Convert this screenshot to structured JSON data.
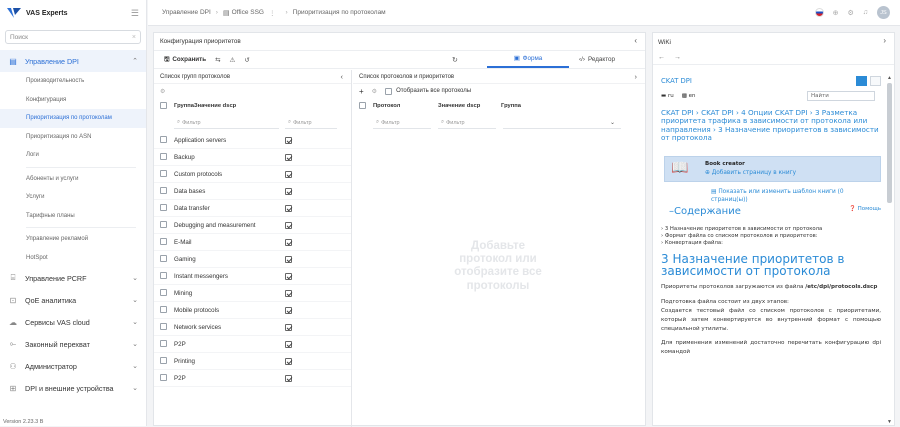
{
  "app": {
    "brand": "VAS Experts",
    "version": "Version 2.23.3 B"
  },
  "sidebar": {
    "search_placeholder": "Поиск",
    "groups": [
      {
        "label": "Управление DPI",
        "icon": "dpi-icon",
        "expanded": true
      },
      {
        "label": "Управление PCRF",
        "icon": "pcrf-icon"
      },
      {
        "label": "QoE аналитика",
        "icon": "qoe-icon"
      },
      {
        "label": "Сервисы VAS cloud",
        "icon": "cloud-icon"
      },
      {
        "label": "Законный перехват",
        "icon": "intercept-icon"
      },
      {
        "label": "Администратор",
        "icon": "admin-icon"
      },
      {
        "label": "DPI и внешние устройства",
        "icon": "devices-icon"
      }
    ],
    "dpi_items": [
      {
        "label": "Производительность"
      },
      {
        "label": "Конфигурация"
      },
      {
        "label": "Приоритизация по протоколам",
        "active": true
      },
      {
        "label": "Приоритизация по ASN"
      },
      {
        "label": "Логи"
      },
      {
        "label": "Абоненты и услуги"
      },
      {
        "label": "Услуги"
      },
      {
        "label": "Тарифные планы"
      },
      {
        "label": "Управление рекламой"
      },
      {
        "label": "HotSpot"
      }
    ]
  },
  "header": {
    "crumb1": "Управление DPI",
    "crumb2": "Office SSG",
    "crumb3": "Приоритизация по протоколам",
    "avatar": "JS"
  },
  "config": {
    "title": "Конфигурация приоритетов",
    "save": "Сохранить",
    "tab_form": "Форма",
    "tab_editor": "Редактор",
    "groups_title": "Список групп протоколов",
    "protocols_title": "Список протоколов и приоритетов",
    "show_all": "Отобразить все протоколы",
    "groups_cols": {
      "group": "Группа",
      "dscp": "Значение dscp"
    },
    "proto_cols": {
      "proto": "Протокол",
      "dscp": "Значение dscp",
      "group": "Группа"
    },
    "filter_ph": "Фильтр",
    "groups": [
      "Application servers",
      "Backup",
      "Custom protocols",
      "Data bases",
      "Data transfer",
      "Debugging and measurement",
      "E-Mail",
      "Gaming",
      "Instant messengers",
      "Mining",
      "Mobile protocols",
      "Network services",
      "P2P",
      "Printing",
      "P2P"
    ],
    "empty_msg": "Добавьте протокол или отобразите все протоколы"
  },
  "wiki": {
    "title": "WiKi",
    "doc_title": "CKAT DPI",
    "lang_ru": "ru",
    "lang_en": "en",
    "find": "Найти",
    "breadcrumbs": "CKAT DPI › CKAT DPI › 4 Опции CKAT DPI › 3 Разметка приоритета трафика в зависимости от протокола или направления › 3 Назначение приоритетов в зависимости от протокола",
    "book_title": "Book creator",
    "book_add": "Добавить страницу в книгу",
    "tpl": "Показать или изменить шаблон книги (0 страниц(ы))",
    "toc": "Содержание",
    "help": "Помощь",
    "toc_items": [
      "3 Назначение приоритетов в зависимости от протокола",
      "Формат файла со списком протоколов и приоритетов:",
      "Конвертация файла:"
    ],
    "heading": "3 Назначение приоритетов в зависимости от протокола",
    "p1a": "Приоритеты протоколов загружаются из файла",
    "p1b": "/etc/dpi/protocols.dscp",
    "p2": "Подготовка файла состоит из двух этапов:",
    "p3": "Создается тестовый файл со списком протоколов с приоритетами, который затем конвертируется во внутренний формат с помощью специальной утилиты.",
    "p4": "Для применения изменений достаточно перечитать конфигурацию dpi командой"
  }
}
